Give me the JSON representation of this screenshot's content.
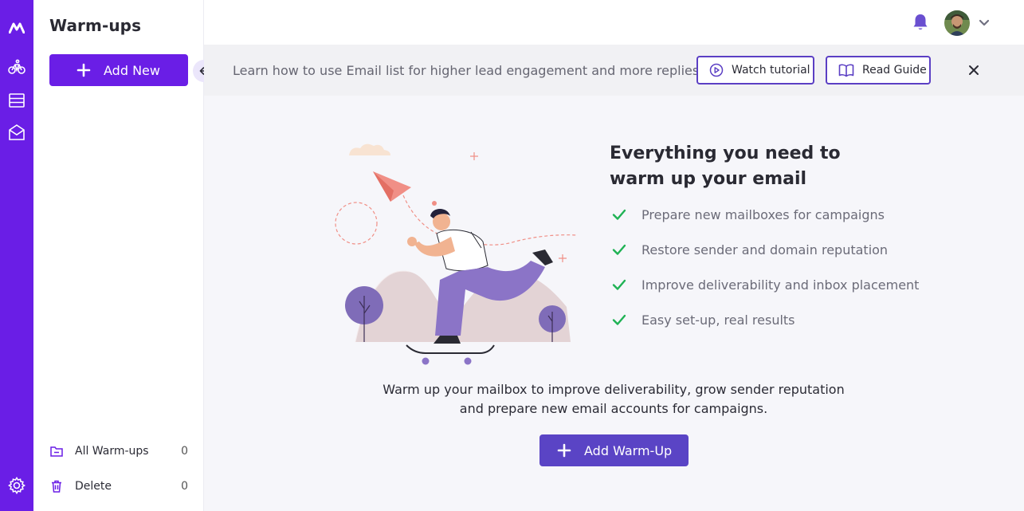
{
  "sidebar": {
    "title": "Warm-ups",
    "add_new_label": "Add New",
    "folders": [
      {
        "name": "All Warm-ups",
        "count": "0"
      },
      {
        "name": "Delete",
        "count": "0"
      }
    ]
  },
  "banner": {
    "text": "Learn how to use Email list for higher lead engagement and more replies",
    "watch_label": "Watch tutorial",
    "guide_label": "Read Guide"
  },
  "main": {
    "heading_line1": "Everything you need to",
    "heading_line2": "warm up your email",
    "features": [
      "Prepare new mailboxes for campaigns",
      "Restore sender and domain reputation",
      "Improve deliverability and inbox placement",
      "Easy set-up, real results"
    ],
    "description_line1": "Warm up your mailbox to improve deliverability, grow sender reputation",
    "description_line2": "and prepare new email accounts for campaigns.",
    "add_warmup_label": "Add Warm-Up"
  },
  "colors": {
    "brand": "#6a1ee6",
    "button_primary": "#5a44c5",
    "check": "#1fb254",
    "banner_bg": "#f1f1f4",
    "main_bg": "#f6f6fa"
  },
  "icons": {
    "rail": [
      "logo-icon",
      "bike-icon",
      "list-icon",
      "mailbox-icon",
      "settings-icon"
    ],
    "header": [
      "bell-icon",
      "avatar",
      "chevron-down-icon"
    ]
  }
}
